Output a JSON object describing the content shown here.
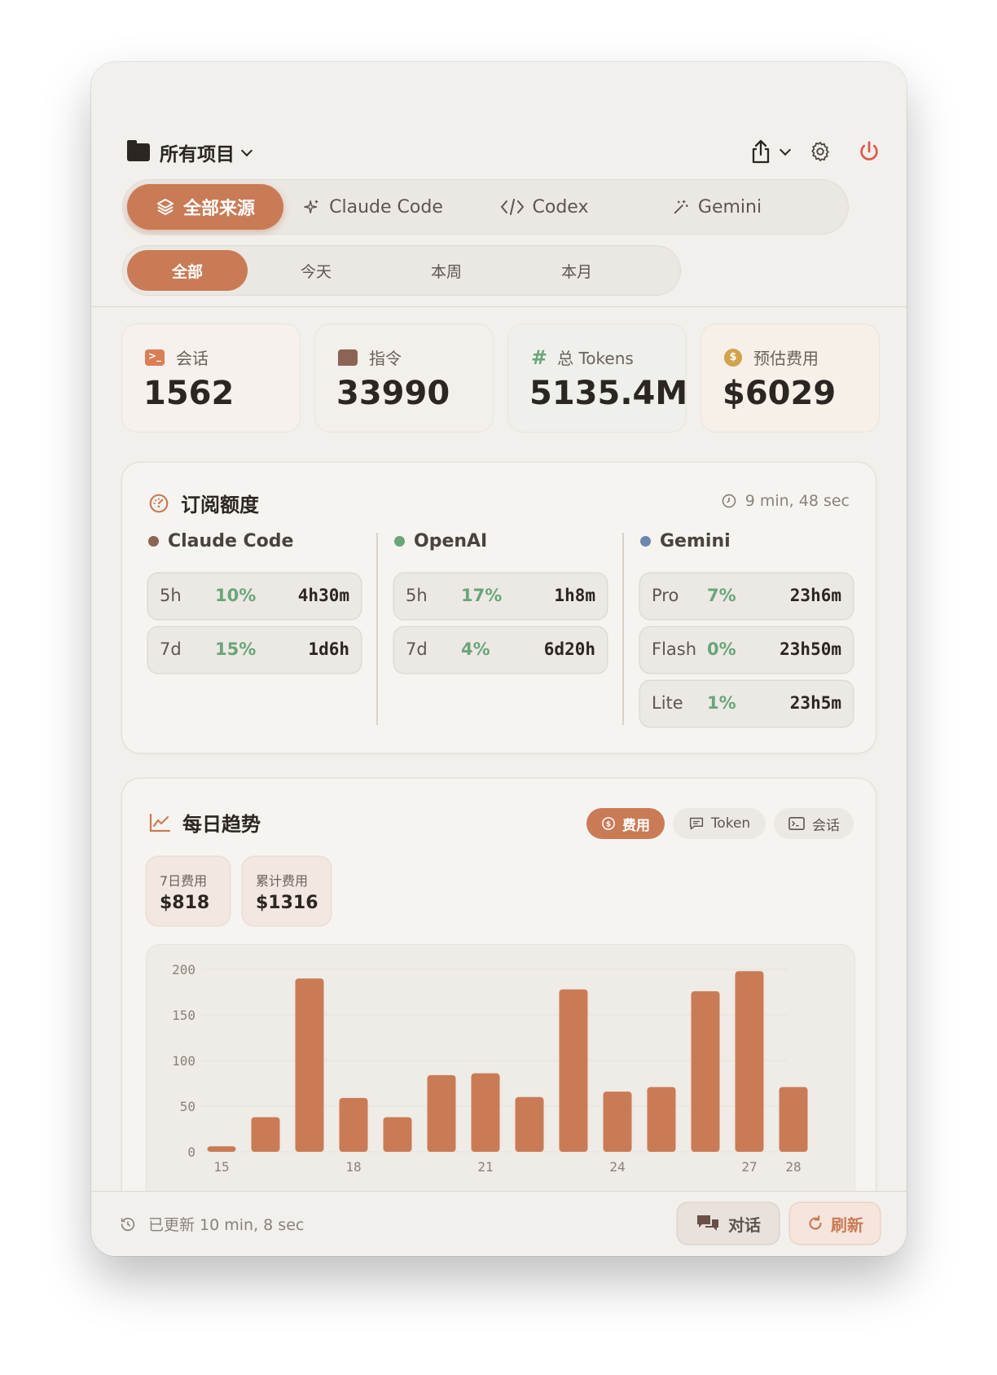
{
  "header": {
    "project_label": "所有项目"
  },
  "sources": [
    {
      "label": "全部来源",
      "icon": "layers-icon",
      "active": true
    },
    {
      "label": "Claude Code",
      "icon": "sparkle-icon",
      "active": false
    },
    {
      "label": "Codex",
      "icon": "code-icon",
      "active": false
    },
    {
      "label": "Gemini",
      "icon": "magic-wand-icon",
      "active": false
    }
  ],
  "time_ranges": [
    {
      "label": "全部",
      "active": true
    },
    {
      "label": "今天",
      "active": false
    },
    {
      "label": "本周",
      "active": false
    },
    {
      "label": "本月",
      "active": false
    }
  ],
  "stats": [
    {
      "label": "会话",
      "value": "1562",
      "icon": "terminal-icon"
    },
    {
      "label": "指令",
      "value": "33990",
      "icon": "message-icon"
    },
    {
      "label": "总 Tokens",
      "value": "5135.4M",
      "icon": "hash-icon"
    },
    {
      "label": "预估费用",
      "value": "$6029",
      "icon": "dollar-coin-icon"
    }
  ],
  "subscription": {
    "title": "订阅额度",
    "refresh_text": "9 min, 48 sec",
    "providers": [
      {
        "name": "Claude Code",
        "color": "#8c6456",
        "rows": [
          {
            "window": "5h",
            "percent": "10%",
            "reset": "4h30m"
          },
          {
            "window": "7d",
            "percent": "15%",
            "reset": "1d6h"
          }
        ]
      },
      {
        "name": "OpenAI",
        "color": "#6aa579",
        "rows": [
          {
            "window": "5h",
            "percent": "17%",
            "reset": "1h8m"
          },
          {
            "window": "7d",
            "percent": "4%",
            "reset": "6d20h"
          }
        ]
      },
      {
        "name": "Gemini",
        "color": "#6d86ad",
        "rows": [
          {
            "window": "Pro",
            "percent": "7%",
            "reset": "23h6m"
          },
          {
            "window": "Flash",
            "percent": "0%",
            "reset": "23h50m"
          },
          {
            "window": "Lite",
            "percent": "1%",
            "reset": "23h5m"
          }
        ]
      }
    ]
  },
  "trend": {
    "title": "每日趋势",
    "tabs": [
      {
        "label": "费用",
        "active": true
      },
      {
        "label": "Token",
        "active": false
      },
      {
        "label": "会话",
        "active": false
      }
    ],
    "summary": [
      {
        "label": "7日费用",
        "value": "$818"
      },
      {
        "label": "累计费用",
        "value": "$1316"
      }
    ]
  },
  "chart_data": {
    "type": "bar",
    "categories": [
      "15",
      "16",
      "17",
      "18",
      "19",
      "20",
      "21",
      "22",
      "23",
      "24",
      "25",
      "26",
      "27",
      "28"
    ],
    "x_tick_labels": [
      "15",
      "",
      "",
      "18",
      "",
      "",
      "21",
      "",
      "",
      "24",
      "",
      "",
      "27",
      "28"
    ],
    "values": [
      6,
      38,
      190,
      59,
      38,
      84,
      86,
      60,
      178,
      66,
      71,
      176,
      198,
      71
    ],
    "yticks": [
      0,
      50,
      100,
      150,
      200
    ],
    "ylim": [
      0,
      200
    ],
    "bar_color": "#c97b56",
    "grid": true
  },
  "footer": {
    "updated_text": "已更新 10 min, 8 sec",
    "chat_label": "对话",
    "refresh_label": "刷新"
  },
  "colors": {
    "accent": "#c97b56",
    "positive": "#6aa579",
    "power": "#e05a4a"
  }
}
